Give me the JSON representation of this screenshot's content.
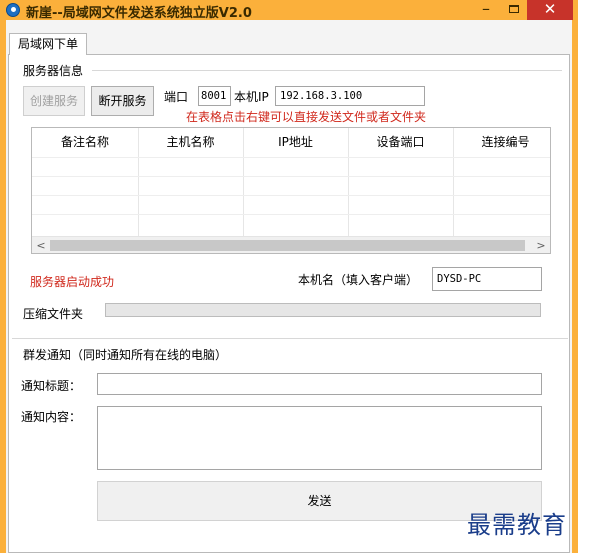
{
  "window": {
    "title": "新崖--局域网文件发送系统独立版V2.0",
    "minimize": "–",
    "close": "✕"
  },
  "tabs": [
    {
      "label": "局域网下单",
      "active": true
    }
  ],
  "server_group": {
    "title": "服务器信息",
    "create_button": "创建服务",
    "disconnect_button": "断开服务",
    "port_label": "端口",
    "port_value": "8001",
    "ip_label": "本机IP",
    "ip_value": "192.168.3.100",
    "hint": "在表格点击右键可以直接发送文件或者文件夹"
  },
  "grid": {
    "columns": [
      "备注名称",
      "主机名称",
      "IP地址",
      "设备端口",
      "连接编号"
    ],
    "rows": []
  },
  "status": {
    "message": "服务器启动成功",
    "hostname_label": "本机名（填入客户端）",
    "hostname_value": "DYSD-PC",
    "compress_label": "压缩文件夹",
    "compress_progress": 0
  },
  "broadcast": {
    "title": "群发通知（同时通知所有在线的电脑）",
    "subject_label": "通知标题：",
    "subject_value": "",
    "content_label": "通知内容：",
    "content_value": "",
    "send_button": "发送"
  },
  "watermark": "最需教育",
  "colors": {
    "titlebar": "#fbb03b",
    "close": "#c7332a",
    "status_red": "#d0281c",
    "watermark": "#1a3d8a"
  }
}
